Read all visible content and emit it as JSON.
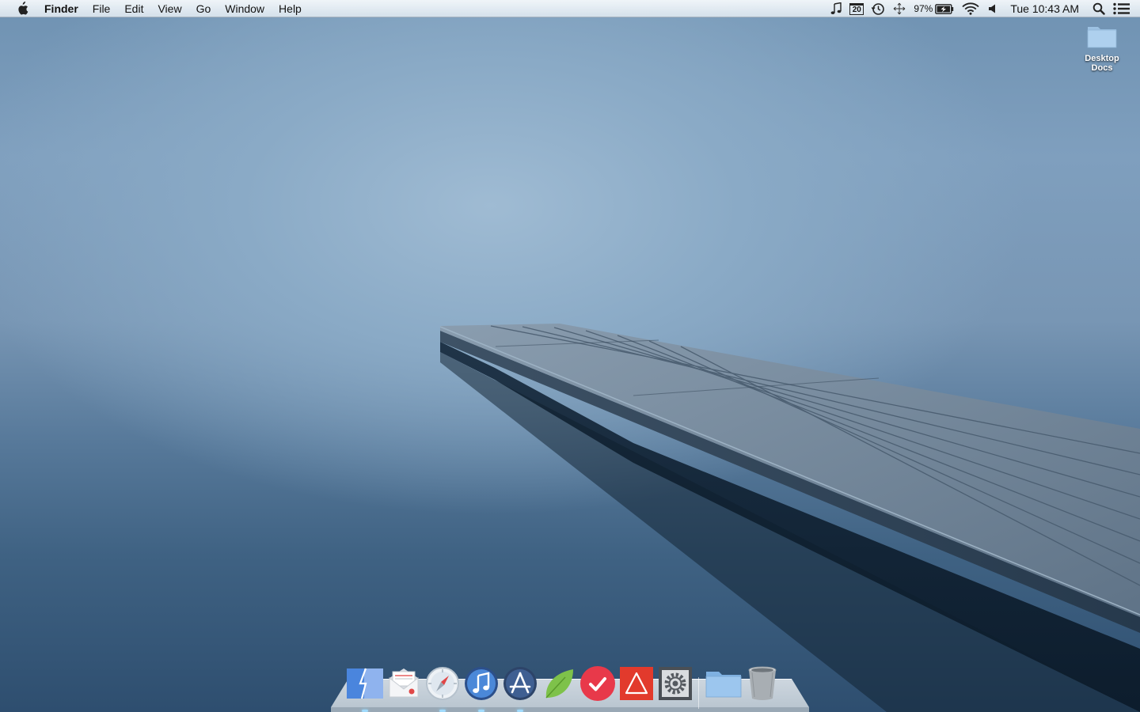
{
  "menubar": {
    "app_name": "Finder",
    "menus": [
      "File",
      "Edit",
      "View",
      "Go",
      "Window",
      "Help"
    ],
    "calendar_date": "20",
    "battery_percent": "97%",
    "clock": "Tue 10:43 AM"
  },
  "desktop": {
    "icons": [
      {
        "label": "Desktop\nDocs"
      }
    ]
  },
  "dock": {
    "items": [
      {
        "name": "finder",
        "running": true
      },
      {
        "name": "mail",
        "running": false
      },
      {
        "name": "safari",
        "running": true
      },
      {
        "name": "itunes",
        "running": true
      },
      {
        "name": "app-store",
        "running": true
      },
      {
        "name": "leaf-app",
        "running": false
      },
      {
        "name": "todo-app",
        "running": false
      },
      {
        "name": "red-triangle-app",
        "running": false
      },
      {
        "name": "system-preferences",
        "running": false
      }
    ],
    "stack_items": [
      {
        "name": "documents-folder"
      },
      {
        "name": "trash"
      }
    ]
  }
}
